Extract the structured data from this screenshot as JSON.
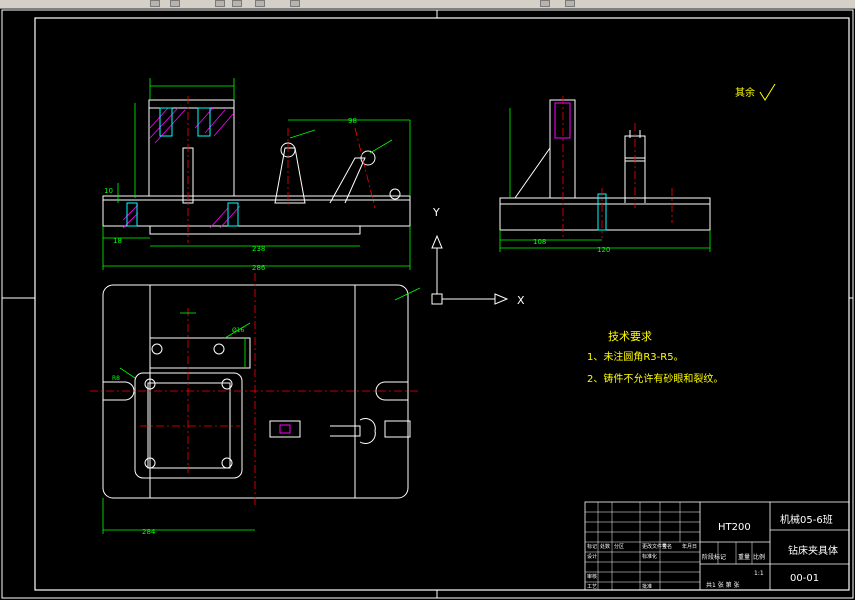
{
  "canvas": {
    "background": "#000000"
  },
  "colors": {
    "frame": "#ffffff",
    "outline": "#ffffff",
    "dimension": "#00ff00",
    "centerline": "#ff0000",
    "hatch": "#ff00ff",
    "note": "#ffff00",
    "hidden": "#00ffff"
  },
  "roughness_note": "其余",
  "tech_requirements": {
    "title": "技术要求",
    "items": [
      "1、未注圆角R3-R5。",
      "2、铸件不允许有砂眼和裂纹。"
    ]
  },
  "ucs_icon": {
    "x_label": "X",
    "y_label": "Y"
  },
  "dimensions": {
    "front_total": "286",
    "front_mid": "238",
    "front_left": "18",
    "front_span": "98",
    "front_height": "10",
    "side_total": "120",
    "side_partial": "108",
    "plan_width": "284",
    "hole_d": "Ø16",
    "radius": "R8"
  },
  "title_block": {
    "material": "HT200",
    "school": "机械05-6班",
    "part_name": "钻床夹具体",
    "drawing_no": "00-01",
    "scale_header": "阶段标记",
    "weight_header": "重量",
    "scale_label": "比例",
    "scale_value": "1:1",
    "sheet_info": "共1  张 第 张",
    "design_label": "设计",
    "check_label": "审核",
    "process_label": "工艺",
    "approve_label": "批准",
    "mark_label": "标记",
    "count_label": "处数",
    "zone_label": "分区",
    "doc_label": "更改文件号",
    "sign_label": "签名",
    "date_label": "年月日",
    "std_label": "标准化"
  }
}
